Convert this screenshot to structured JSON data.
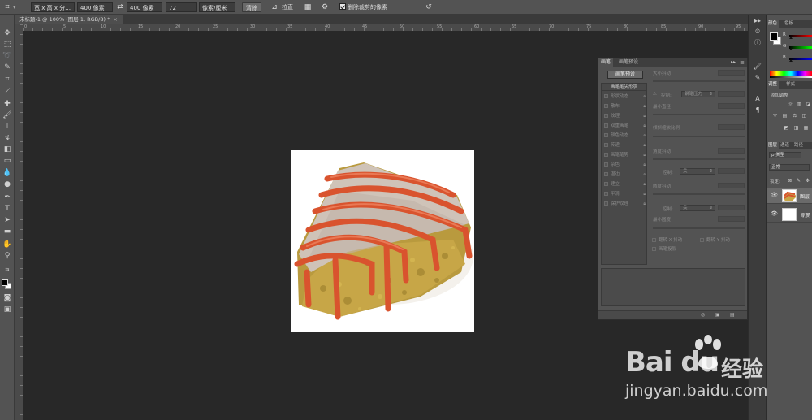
{
  "options_bar": {
    "ratio": "宽 x 高 x 分…",
    "width": "400 像素",
    "height": "400 像素",
    "resolution": "72",
    "units": "像素/厘米",
    "clear": "清除",
    "straighten": "拉直",
    "delete_cropped": "删除裁剪的像素"
  },
  "document": {
    "tab_title": "未标题-1 @ 100% (图层 1, RGB/8) *",
    "close": "×"
  },
  "ruler_top_numbers": [
    "0",
    "5",
    "10",
    "15",
    "20",
    "25",
    "30",
    "35",
    "40",
    "45",
    "50",
    "55",
    "60",
    "65",
    "70",
    "75",
    "80",
    "85",
    "90",
    "95"
  ],
  "brush_panel": {
    "tabs": [
      "画笔",
      "画笔预设"
    ],
    "preset_button": "画笔预设",
    "list_header": "画笔笔尖形状",
    "items": [
      "形状动态",
      "散布",
      "纹理",
      "双重画笔",
      "颜色动态",
      "传递",
      "画笔笔势",
      "杂色",
      "湿边",
      "建立",
      "平滑",
      "保护纹理"
    ],
    "size_jitter": "大小抖动",
    "control": "控制:",
    "pen_pressure": "钢笔压力",
    "min_diameter": "最小直径",
    "tilt_scale": "倾斜缩放比例",
    "angle_jitter": "角度抖动",
    "off": "关",
    "roundness_jitter": "圆度抖动",
    "min_roundness": "最小圆度",
    "flip_x": "翻转 X 抖动",
    "flip_y": "翻转 Y 抖动",
    "brush_projection": "画笔投影"
  },
  "color_panel": {
    "tabs": [
      "颜色",
      "色板"
    ],
    "channels": [
      "R",
      "G",
      "B"
    ]
  },
  "adjust_panel": {
    "tabs": [
      "调整",
      "样式"
    ],
    "add_adjustment": "添加调整"
  },
  "layers_panel": {
    "tabs": [
      "图层",
      "通道",
      "路径"
    ],
    "filter": "ρ 类型",
    "blend_mode": "正常",
    "lock": "锁定:",
    "layers": [
      {
        "name": "图层",
        "selected": true
      },
      {
        "name": "背景",
        "selected": false
      }
    ]
  },
  "watermark": {
    "brand": "Bai du",
    "cn": "经验",
    "url": "jingyan.baidu.com"
  }
}
